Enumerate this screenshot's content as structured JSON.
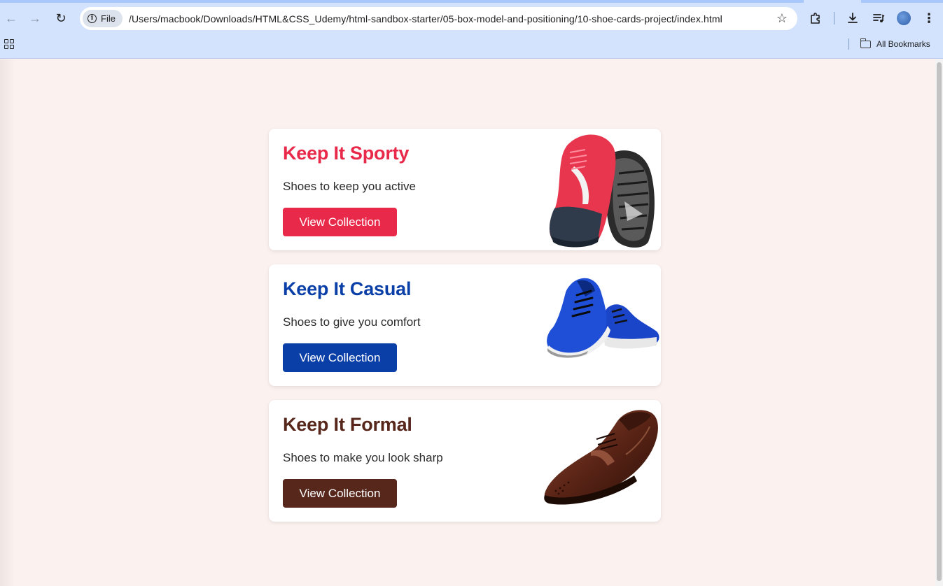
{
  "browser": {
    "site_chip": "File",
    "url": "/Users/macbook/Downloads/HTML&CSS_Udemy/html-sandbox-starter/05-box-model-and-positioning/10-shoe-cards-project/index.html",
    "bookmarks_label": "All Bookmarks",
    "icons": [
      "back-icon",
      "forward-icon",
      "reload-icon",
      "info-icon",
      "star-icon",
      "extensions-icon",
      "download-icon",
      "media-icon",
      "avatar",
      "menu-icon",
      "apps-icon",
      "folder-icon"
    ]
  },
  "colors": {
    "page_bg": "#fbf1ef",
    "sporty": "#e8294a",
    "casual": "#0b3fa8",
    "formal": "#57271b"
  },
  "cards": [
    {
      "title": "Keep It Sporty",
      "subtitle": "Shoes to keep you active",
      "button": "View Collection",
      "image": "red-sneakers"
    },
    {
      "title": "Keep It Casual",
      "subtitle": "Shoes to give you comfort",
      "button": "View Collection",
      "image": "blue-sneakers"
    },
    {
      "title": "Keep It Formal",
      "subtitle": "Shoes to make you look sharp",
      "button": "View Collection",
      "image": "brown-oxford-shoe"
    }
  ]
}
